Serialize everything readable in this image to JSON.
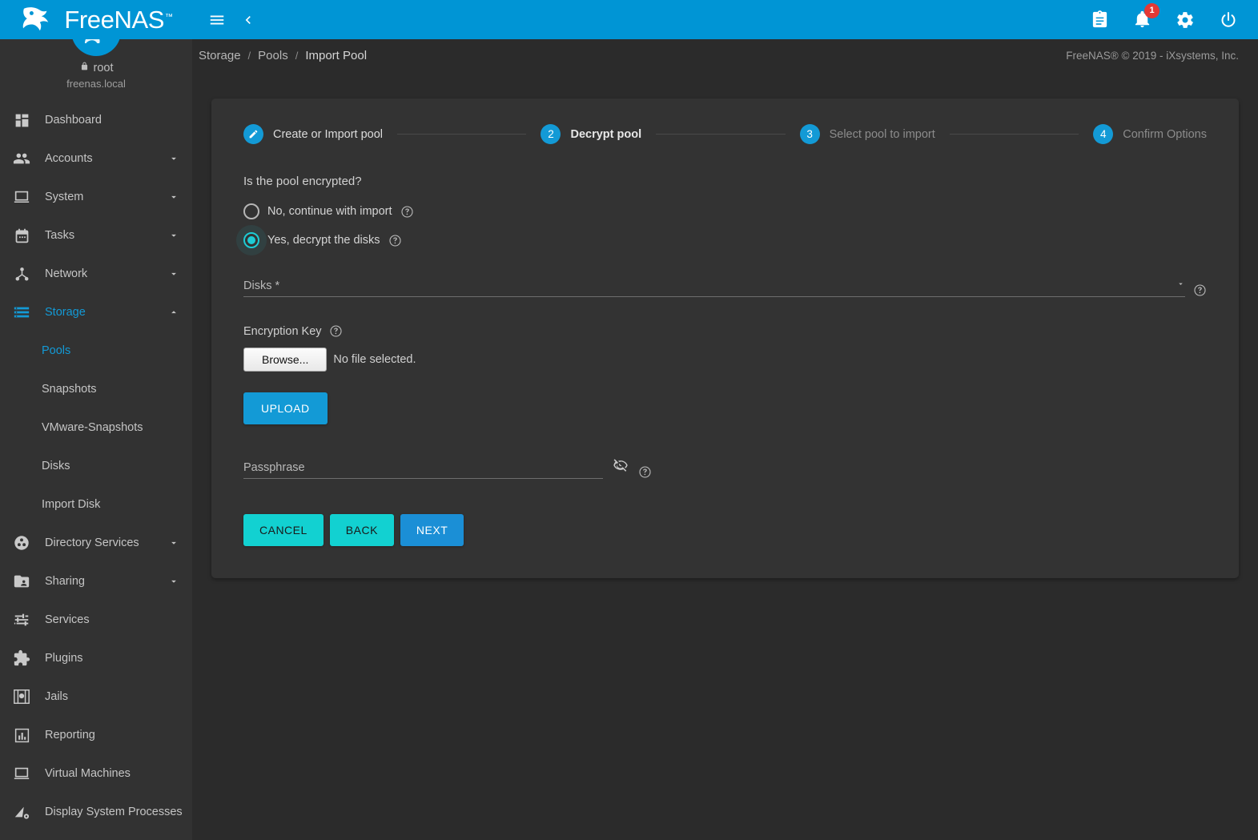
{
  "app": {
    "brand": "FreeNAS",
    "brand_tm": "™",
    "accent_blue": "#0095d5",
    "accent_cyan": "#12d1d1",
    "page_bg": "#2b2b2b",
    "card_bg": "#333333"
  },
  "topbar": {
    "menu_icon": "hamburger-menu-icon",
    "back_icon": "chevron-left-icon",
    "clipboard_icon": "clipboard-icon",
    "notifications_icon": "bell-icon",
    "notification_count": "1",
    "settings_icon": "gear-icon",
    "power_icon": "power-icon"
  },
  "sidebar": {
    "user": {
      "avatar_label": "",
      "lock_icon": "lock-icon",
      "name": "root",
      "host": "freenas.local"
    },
    "items": [
      {
        "label": "Dashboard",
        "icon": "dashboard-icon",
        "expandable": false,
        "active": false
      },
      {
        "label": "Accounts",
        "icon": "people-icon",
        "expandable": true,
        "active": false
      },
      {
        "label": "System",
        "icon": "laptop-icon",
        "expandable": true,
        "active": false
      },
      {
        "label": "Tasks",
        "icon": "calendar-icon",
        "expandable": true,
        "active": false
      },
      {
        "label": "Network",
        "icon": "share-nodes-icon",
        "expandable": true,
        "active": false
      },
      {
        "label": "Storage",
        "icon": "storage-icon",
        "expandable": true,
        "active": true,
        "expanded": true
      },
      {
        "label": "Directory Services",
        "icon": "directory-icon",
        "expandable": true,
        "active": false
      },
      {
        "label": "Sharing",
        "icon": "folder-shared-icon",
        "expandable": true,
        "active": false
      },
      {
        "label": "Services",
        "icon": "sliders-icon",
        "expandable": false,
        "active": false
      },
      {
        "label": "Plugins",
        "icon": "puzzle-icon",
        "expandable": false,
        "active": false
      },
      {
        "label": "Jails",
        "icon": "jail-icon",
        "expandable": false,
        "active": false
      },
      {
        "label": "Reporting",
        "icon": "bar-chart-icon",
        "expandable": false,
        "active": false
      },
      {
        "label": "Virtual Machines",
        "icon": "monitor-icon",
        "expandable": false,
        "active": false
      },
      {
        "label": "Display System Processes",
        "icon": "processes-icon",
        "expandable": false,
        "active": false
      }
    ],
    "storage_children": [
      {
        "label": "Pools",
        "active": true
      },
      {
        "label": "Snapshots",
        "active": false
      },
      {
        "label": "VMware-Snapshots",
        "active": false
      },
      {
        "label": "Disks",
        "active": false
      },
      {
        "label": "Import Disk",
        "active": false
      }
    ]
  },
  "breadcrumb": {
    "items": [
      "Storage",
      "Pools",
      "Import Pool"
    ],
    "separator": "/"
  },
  "footer": {
    "copyright": "FreeNAS® © 2019 - iXsystems, Inc."
  },
  "wizard": {
    "steps": [
      {
        "number": "1",
        "label": "Create or Import pool",
        "state": "done",
        "icon": "pencil-icon"
      },
      {
        "number": "2",
        "label": "Decrypt pool",
        "state": "active"
      },
      {
        "number": "3",
        "label": "Select pool to import",
        "state": "pending"
      },
      {
        "number": "4",
        "label": "Confirm Options",
        "state": "pending"
      }
    ]
  },
  "form": {
    "question": "Is the pool encrypted?",
    "options": [
      {
        "label": "No, continue with import",
        "selected": false,
        "help_icon": "help-circle-icon"
      },
      {
        "label": "Yes, decrypt the disks",
        "selected": true,
        "help_icon": "help-circle-icon"
      }
    ],
    "disks": {
      "label": "Disks *",
      "value": "",
      "dropdown_icon": "chevron-down-icon",
      "help_icon": "help-circle-icon"
    },
    "encryption_key": {
      "label": "Encryption Key",
      "help_icon": "help-circle-icon",
      "browse_label": "Browse...",
      "file_status": "No file selected.",
      "upload_label": "UPLOAD"
    },
    "passphrase": {
      "placeholder": "Passphrase",
      "value": "",
      "visibility_icon": "eye-off-icon",
      "help_icon": "help-circle-icon"
    },
    "buttons": {
      "cancel": "CANCEL",
      "back": "BACK",
      "next": "NEXT"
    }
  }
}
